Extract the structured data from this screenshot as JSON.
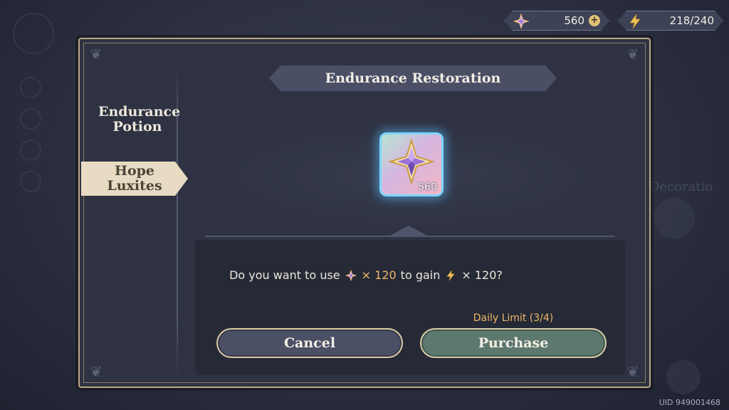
{
  "currency": {
    "luxites": {
      "icon": "hope-luxite-icon",
      "value": "560",
      "add_icon": "+"
    },
    "energy": {
      "icon": "lightning-icon",
      "value": "218/240"
    }
  },
  "dialog": {
    "title": "Endurance Restoration",
    "tabs": [
      {
        "label_line1": "Endurance",
        "label_line2": "Potion",
        "selected": false
      },
      {
        "label_line1": "Hope",
        "label_line2": "Luxites",
        "selected": true
      }
    ],
    "item": {
      "icon": "hope-luxite-icon",
      "count": "560"
    },
    "question": {
      "prefix": "Do you want to use",
      "cost": "× 120",
      "middle": "to gain",
      "gain": "× 120?"
    },
    "daily_limit": "Daily Limit (3/4)",
    "cancel_label": "Cancel",
    "purchase_label": "Purchase"
  },
  "background": {
    "decorations_label": "Decoratio"
  },
  "uid": "UID 949001468",
  "colors": {
    "accent_gold": "#f0b768",
    "frame_gold": "#bda985",
    "purchase_green": "#5d786f"
  }
}
